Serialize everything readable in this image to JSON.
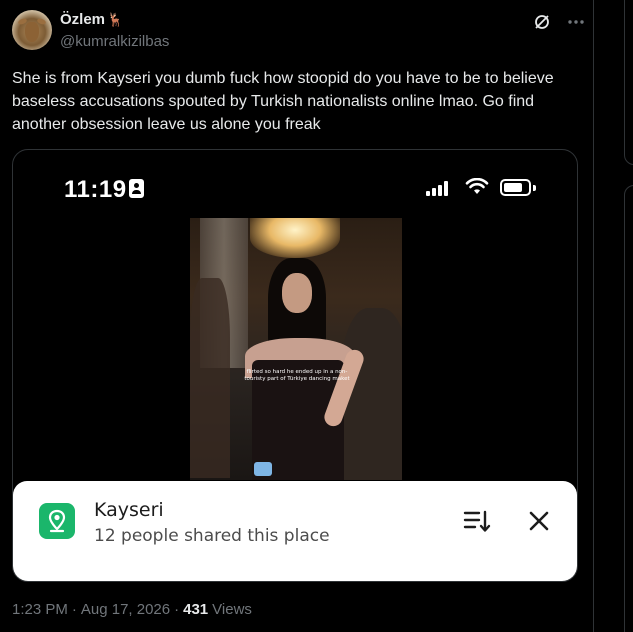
{
  "author": {
    "display_name": "Özlem",
    "name_emoji": "🦌",
    "handle": "@kumralkizilbas"
  },
  "actions": {
    "grok_icon": "grok-icon",
    "more_icon": "more-icon"
  },
  "tweet": {
    "text": "She is from Kayseri you dumb fuck how stoopid do you have to be to believe baseless accusations spouted by Turkish nationalists online lmao. Go find another obsession leave us alone you freak"
  },
  "media": {
    "status_bar": {
      "time": "11:19",
      "signal_bars": 4,
      "battery_level": 0.8
    },
    "video_caption": "flirted so hard he ended up in a non-touristy part of Türkiye dancing maket",
    "place_card": {
      "name": "Kayseri",
      "subtitle": "12 people shared this place",
      "accent_color": "#1bb66b"
    }
  },
  "meta": {
    "time": "1:23 PM",
    "date": "Aug 17, 2026",
    "separator": "·",
    "views_count": "431",
    "views_label": "Views"
  },
  "colors": {
    "background": "#000000",
    "text_primary": "#e7e9ea",
    "text_secondary": "#71767b",
    "border": "#2f3336"
  }
}
